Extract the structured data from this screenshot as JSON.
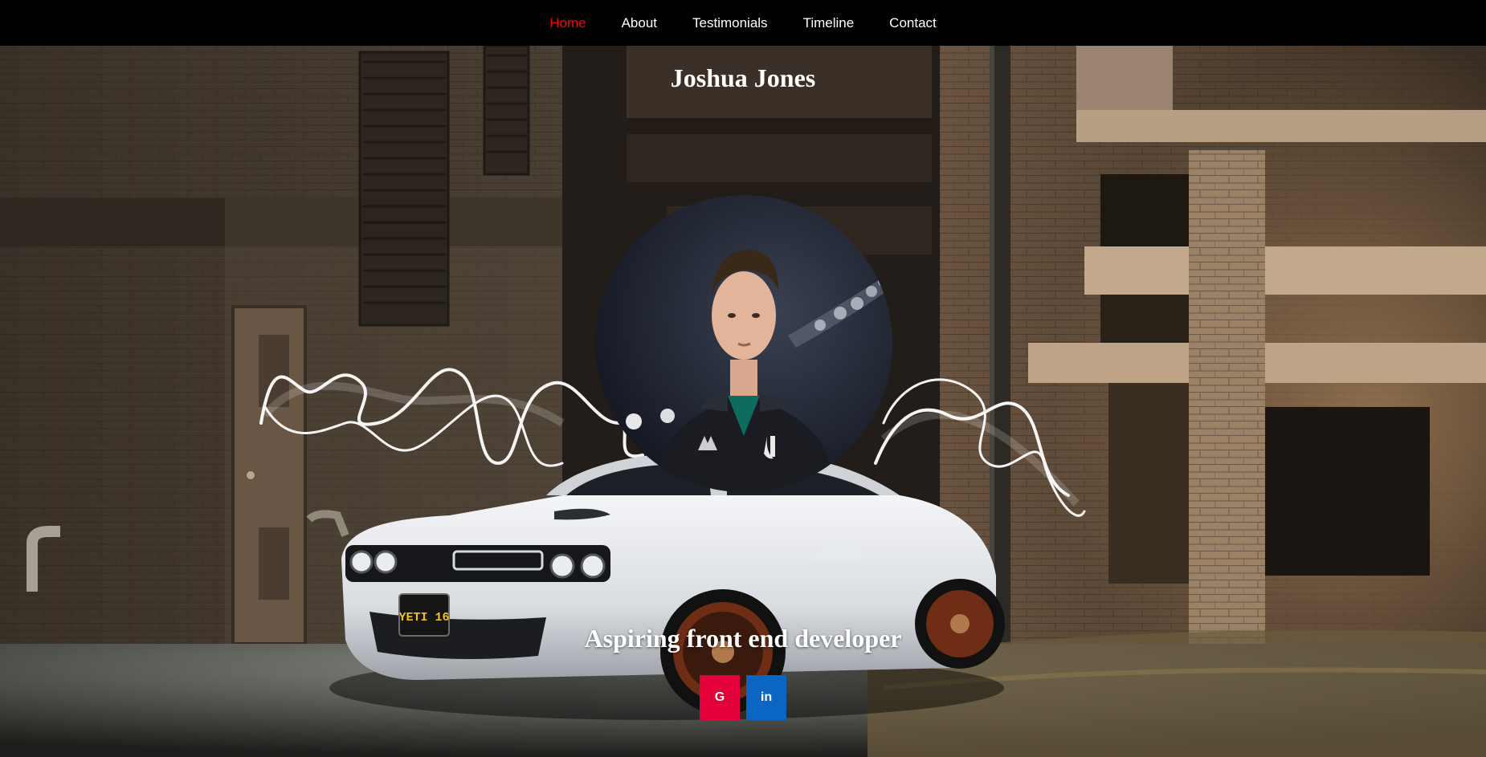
{
  "nav": {
    "items": [
      {
        "label": "Home",
        "active": true
      },
      {
        "label": "About",
        "active": false
      },
      {
        "label": "Testimonials",
        "active": false
      },
      {
        "label": "Timeline",
        "active": false
      },
      {
        "label": "Contact",
        "active": false
      }
    ]
  },
  "hero": {
    "name": "Joshua Jones",
    "tagline": "Aspiring front end developer",
    "plate_text": "YETI 16"
  },
  "social": [
    {
      "name": "google",
      "glyph": "G",
      "color": "#e4003a"
    },
    {
      "name": "linkedin",
      "glyph": "in",
      "color": "#0a66c2"
    }
  ],
  "colors": {
    "nav_bg": "#000000",
    "nav_text": "#ffffff",
    "nav_active": "#ff0000"
  }
}
